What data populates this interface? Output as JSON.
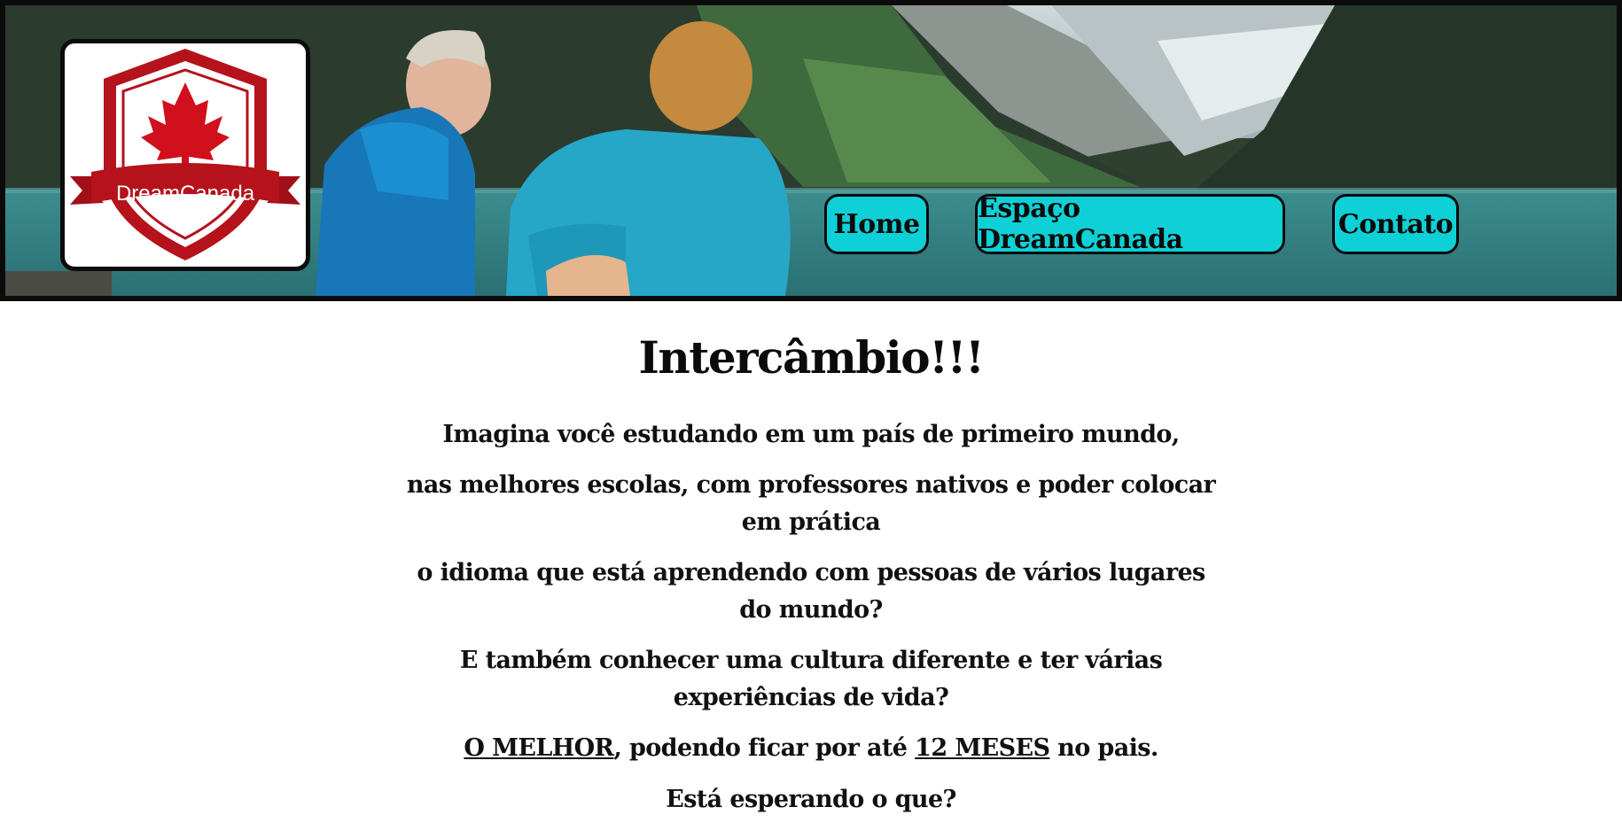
{
  "header": {
    "logo": {
      "text": "DreamCanada"
    },
    "nav": {
      "home": "Home",
      "espaco": "Espaço DreamCanada",
      "contato": "Contato"
    }
  },
  "main": {
    "title": "Intercâmbio!!!",
    "paragraphs": {
      "p1": "Imagina você estudando em um país de primeiro mundo,",
      "p2": "nas melhores escolas, com professores nativos e poder colocar em prática",
      "p3": "o idioma que está aprendendo com pessoas de vários lugares do mundo?",
      "p4": "E também conhecer uma cultura diferente e ter várias experiências de vida?",
      "p5": {
        "u1": "O MELHOR",
        "t1": ", podendo ficar por até ",
        "u2": "12 MESES",
        "t2": " no pais."
      },
      "p6": "Está esperando o que?"
    }
  },
  "colors": {
    "nav_button_bg": "#0fd0d6",
    "logo_red": "#b5121b",
    "border": "#0b0b0b"
  }
}
